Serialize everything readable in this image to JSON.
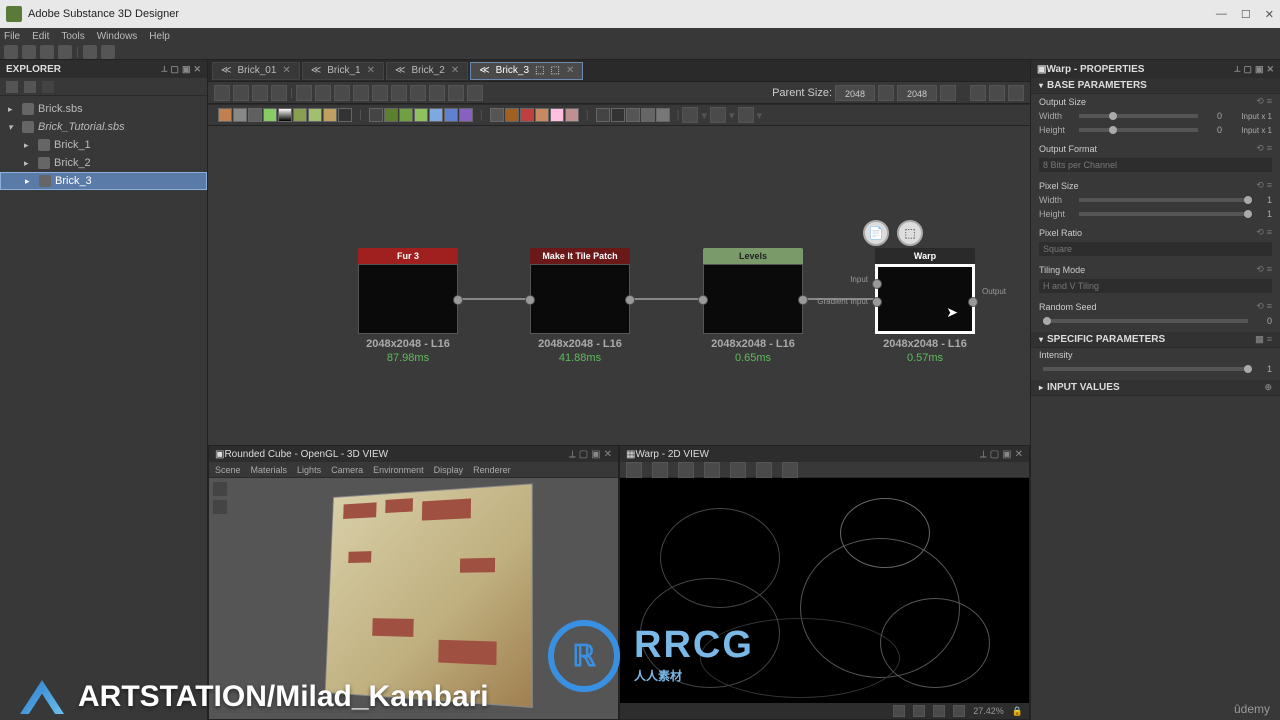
{
  "window": {
    "title": "Adobe Substance 3D Designer"
  },
  "menu": [
    "File",
    "Edit",
    "Tools",
    "Windows",
    "Help"
  ],
  "explorer": {
    "title": "EXPLORER",
    "items": [
      {
        "label": "Brick.sbs",
        "depth": 0,
        "sel": false,
        "arrow": "▸"
      },
      {
        "label": "Brick_Tutorial.sbs",
        "depth": 0,
        "sel": false,
        "arrow": "▾",
        "italic": true
      },
      {
        "label": "Brick_1",
        "depth": 1,
        "sel": false,
        "arrow": "▸"
      },
      {
        "label": "Brick_2",
        "depth": 1,
        "sel": false,
        "arrow": "▸"
      },
      {
        "label": "Brick_3",
        "depth": 1,
        "sel": true,
        "arrow": "▸"
      }
    ]
  },
  "tabs": [
    {
      "label": "Brick_01",
      "active": false
    },
    {
      "label": "Brick_1",
      "active": false
    },
    {
      "label": "Brick_2",
      "active": false
    },
    {
      "label": "Brick_3",
      "active": true
    }
  ],
  "parent_size_label": "Parent Size:",
  "parent_size_value": "2048",
  "size_value": "2048",
  "nodes": {
    "fur": {
      "title": "Fur 3",
      "meta": "2048x2048 - L16",
      "time": "87.98ms"
    },
    "tile": {
      "title": "Make It Tile Patch Gray...",
      "meta": "2048x2048 - L16",
      "time": "41.88ms"
    },
    "levels": {
      "title": "Levels",
      "meta": "2048x2048 - L16",
      "time": "0.65ms"
    },
    "warp": {
      "title": "Warp",
      "meta": "2048x2048 - L16",
      "time": "0.57ms",
      "out_label": "Output",
      "in1_label": "Input",
      "in2_label": "Gradient Input"
    }
  },
  "view3d": {
    "title": "Rounded Cube - OpenGL - 3D VIEW",
    "menu": [
      "Scene",
      "Materials",
      "Lights",
      "Camera",
      "Environment",
      "Display",
      "Renderer"
    ]
  },
  "view2d": {
    "title": "Warp - 2D VIEW",
    "zoom": "27.42% "
  },
  "props": {
    "title": "Warp - PROPERTIES",
    "base_params": "BASE PARAMETERS",
    "output_size": "Output Size",
    "width_label": "Width",
    "width_val": "0",
    "width_link": "Input x 1",
    "height_label": "Height",
    "height_val": "0",
    "height_link": "Input x 1",
    "output_format": "Output Format",
    "output_format_val": "8 Bits per Channel",
    "pixel_size": "Pixel Size",
    "ps_width_label": "Width",
    "ps_width_val": "1",
    "ps_height_label": "Height",
    "ps_height_val": "1",
    "pixel_ratio": "Pixel Ratio",
    "pixel_ratio_val": "Square",
    "tiling_mode": "Tiling Mode",
    "tiling_mode_val": "H and V Tiling",
    "random_seed": "Random Seed",
    "random_seed_val": "0",
    "specific_params": "SPECIFIC PARAMETERS",
    "intensity": "Intensity",
    "intensity_val": "1",
    "input_values": "INPUT VALUES"
  },
  "watermark": {
    "text": "ARTSTATION/Milad_Kambari",
    "rrcg": "RRCG",
    "rrcg_sub": "人人素材",
    "udemy": "ûdemy"
  }
}
